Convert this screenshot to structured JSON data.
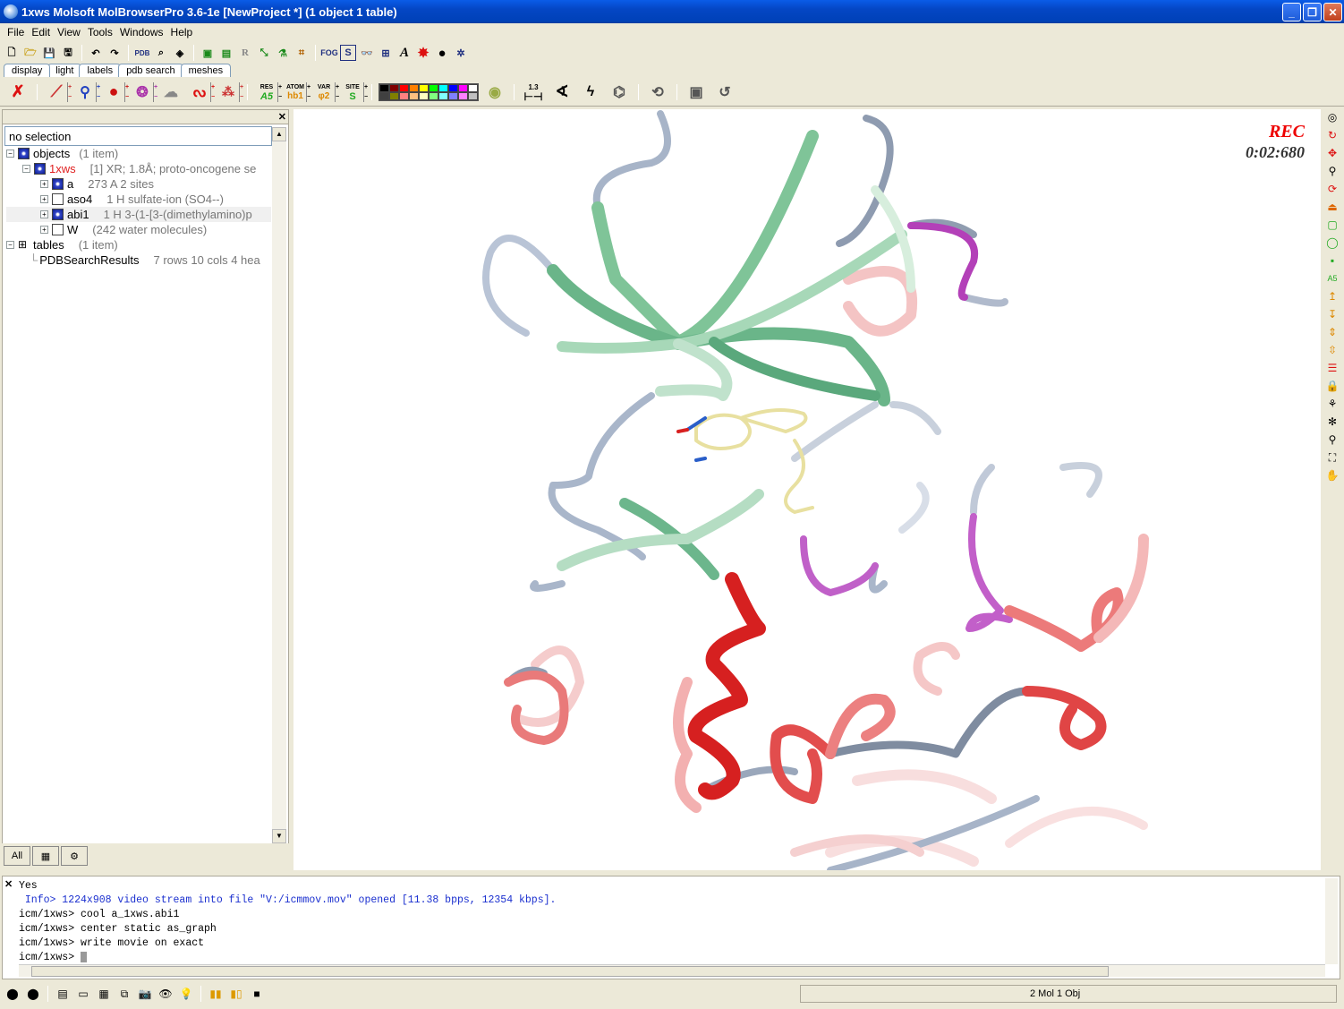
{
  "window": {
    "title": "1xws Molsoft MolBrowserPro 3.6-1e  [NewProject *] (1 object 1 table)",
    "buttons": [
      "_",
      "❐",
      "✕"
    ]
  },
  "menu": [
    "File",
    "Edit",
    "View",
    "Tools",
    "Windows",
    "Help"
  ],
  "toolbar1": {
    "pdb_label": "PDB",
    "fog_label": "FOG",
    "s_label": "S",
    "r_label": "R",
    "a_label": "A"
  },
  "tabs": [
    "display",
    "light",
    "labels",
    "pdb search",
    "meshes"
  ],
  "toolbar2": {
    "res_label": "RES",
    "res_sub": "A5",
    "atom_label": "ATOM",
    "atom_sub": "hb1",
    "var_label": "VAR",
    "var_sub": "φ2",
    "site_label": "SITE",
    "site_sub": "S",
    "dist_label": "1.3",
    "palette_colors": [
      "#000000",
      "#800000",
      "#ff0000",
      "#ff8000",
      "#ffff00",
      "#00ff00",
      "#00ffff",
      "#0000ff",
      "#ff00ff",
      "#ffffff",
      "#404040",
      "#808000",
      "#ff8080",
      "#ffc080",
      "#ffffc0",
      "#80ff80",
      "#80ffff",
      "#8080ff",
      "#ff80ff",
      "#c0c0c0"
    ]
  },
  "left_panel": {
    "selection": "no selection",
    "tree": {
      "objects": {
        "label": "objects",
        "count": "(1 item)"
      },
      "obj_1xws": {
        "label": "1xws",
        "desc": "[1] XR; 1.8Å; proto-oncogene se"
      },
      "a": {
        "label": "a",
        "desc": "273 A  2 sites"
      },
      "aso4": {
        "label": "aso4",
        "desc": "1 H   sulfate-ion (SO4--)"
      },
      "abi1": {
        "label": "abi1",
        "desc": "1 H   3-(1-[3-(dimethylamino)p"
      },
      "w": {
        "label": "W",
        "desc": "(242 water molecules)"
      },
      "tables": {
        "label": "tables",
        "count": "(1 item)"
      },
      "pdbsearch": {
        "label": "PDBSearchResults",
        "desc": "7 rows 10 cols 4 hea"
      }
    },
    "bottom_tabs": [
      "All",
      "▦",
      "⚙"
    ]
  },
  "viewport": {
    "rec_label": "REC",
    "timer": "0:02:680"
  },
  "console": {
    "lines": [
      {
        "text": "Yes",
        "type": "out"
      },
      {
        "text": " Info> 1224x908 video stream into file \"V:/icmmov.mov\" opened [11.38 bpps, 12354 kbps].",
        "type": "info"
      },
      {
        "text": "icm/1xws> cool a_1xws.abi1",
        "type": "cmd"
      },
      {
        "text": "icm/1xws> center static as_graph",
        "type": "cmd"
      },
      {
        "text": "icm/1xws> write movie on exact",
        "type": "cmd"
      },
      {
        "text": "icm/1xws> ",
        "type": "prompt"
      }
    ]
  },
  "status": {
    "text": "2 Mol 1 Obj"
  }
}
